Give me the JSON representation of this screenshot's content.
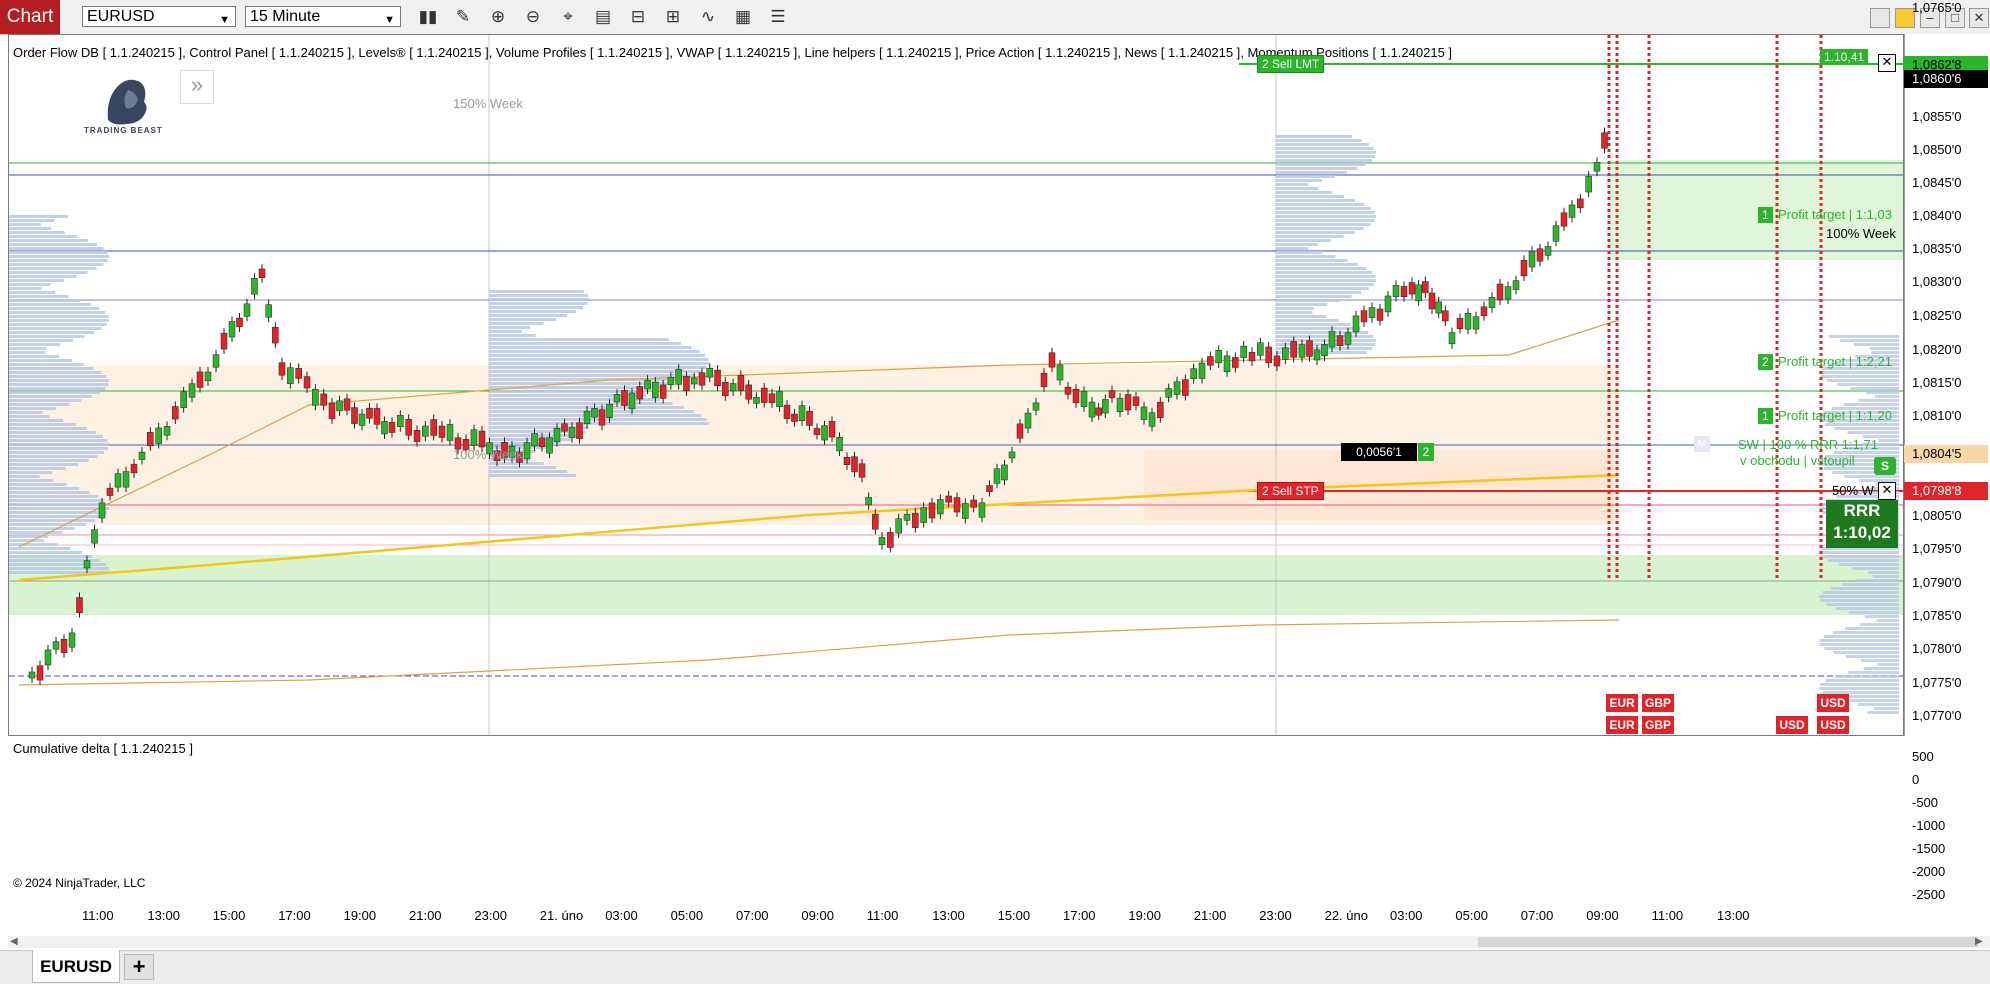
{
  "toolbar": {
    "chart_label": "Chart",
    "instrument": "EURUSD",
    "interval": "15 Minute",
    "tools": [
      "bar-chart-icon",
      "pencil-icon",
      "zoom-in-icon",
      "zoom-out-icon",
      "crosshair-icon",
      "data-box-icon",
      "properties-icon",
      "strategy-icon",
      "indicator-icon",
      "chart-trader-icon",
      "list-icon"
    ]
  },
  "indicator_header": "Order Flow DB   [ 1.1.240215 ], Control Panel   [ 1.1.240215 ], Levels®   [ 1.1.240215 ], Volume Profiles   [ 1.1.240215 ], VWAP   [ 1.1.240215 ], Line helpers   [ 1.1.240215 ], Price Action   [ 1.1.240215 ], News   [ 1.1.240215 ], Momentum Positions   [ 1.1.240215 ]",
  "logo_text": "TRADING BEAST",
  "collapse_glyph": "»",
  "labels": {
    "week150": "150% Week",
    "week100_left": "100% Week",
    "week100_right": "100% Week",
    "week50": "50% W",
    "pt1_103": "Profit target | 1:1,03",
    "pt2_221": "Profit target | 1:2,21",
    "pt1_120": "Profit target | 1:1,20",
    "pt1_num": "1",
    "pt2_num": "2",
    "pt3_num": "1",
    "sell_lmt": "2  Sell LMT",
    "sell_stp": "2  Sell STP",
    "lmt_value": "1.10,41",
    "sw_line": "SW | 100 %   RRR 1:1,71",
    "obchod_line": "v obchodu | vstoupil",
    "pos_value": "0,0056'1",
    "pos_qty": "2",
    "s_badge": "S",
    "m_badge": "M",
    "rrr_title": "RRR",
    "rrr_value": "1:10,02",
    "copyright": "© 2024 NinjaTrader, LLC",
    "cum_delta": "Cumulative delta   [ 1.1.240215 ]"
  },
  "currency_tags": [
    {
      "text": "EUR"
    },
    {
      "text": "GBP"
    },
    {
      "text": "USD"
    },
    {
      "text": "EUR"
    },
    {
      "text": "GBP"
    },
    {
      "text": "USD"
    },
    {
      "text": "USD"
    }
  ],
  "price_tags": {
    "top": "1,0862'8",
    "last": "1,0860'6",
    "mid": "1,0804'5",
    "stop": "1,0798'8"
  },
  "y_ticks": [
    "1,0855'0",
    "1,0850'0",
    "1,0845'0",
    "1,0840'0",
    "1,0835'0",
    "1,0830'0",
    "1,0825'0",
    "1,0820'0",
    "1,0815'0",
    "1,0810'0",
    "1,0805'0",
    "1,0795'0",
    "1,0790'0",
    "1,0785'0",
    "1,0780'0",
    "1,0775'0",
    "1,0770'0",
    "1,0765'0"
  ],
  "delta_ticks": [
    "500",
    "0",
    "-500",
    "-1000",
    "-1500",
    "-2000",
    "-2500"
  ],
  "x_ticks": [
    "11:00",
    "13:00",
    "15:00",
    "17:00",
    "19:00",
    "21:00",
    "23:00",
    "21. úno",
    "03:00",
    "05:00",
    "07:00",
    "09:00",
    "11:00",
    "13:00",
    "15:00",
    "17:00",
    "19:00",
    "21:00",
    "23:00",
    "22. úno",
    "03:00",
    "05:00",
    "07:00",
    "09:00",
    "11:00",
    "13:00"
  ],
  "tab": {
    "name": "EURUSD",
    "add": "+"
  },
  "colors": {
    "chart_tab": "#b41e23",
    "bull": "#2cb52c",
    "bear": "#e0252a",
    "vwap": "#f5c518",
    "band": "#d9a441",
    "profile": "#b7c8e6",
    "poc": "#6f8fc7"
  }
}
